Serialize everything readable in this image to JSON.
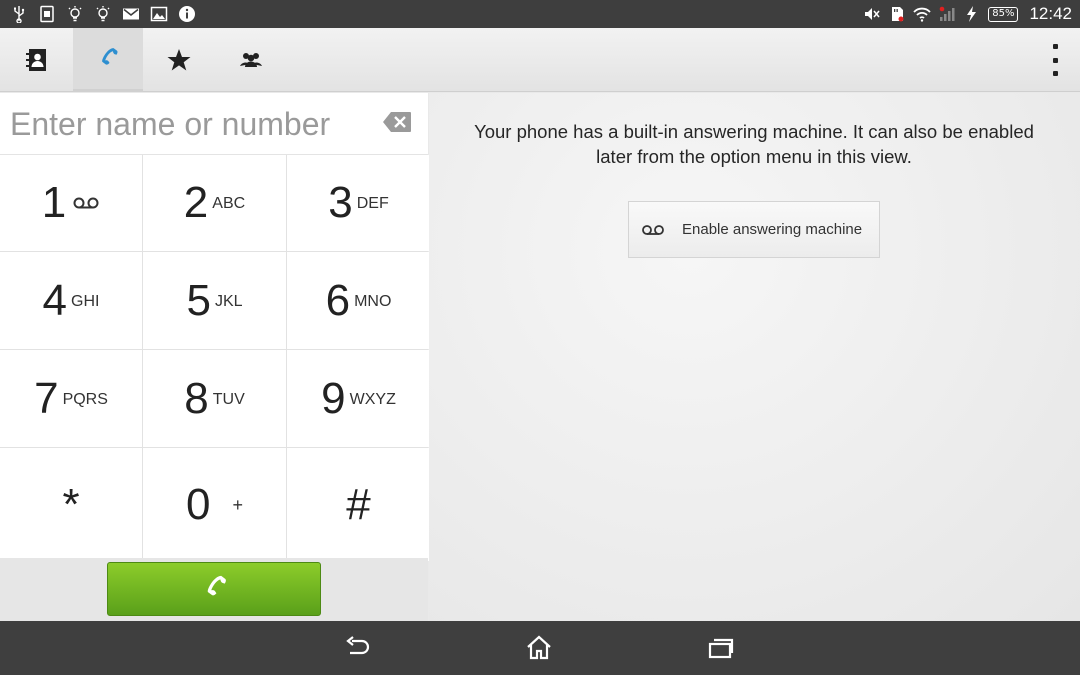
{
  "status_bar": {
    "left_icons": [
      "usb-icon",
      "sim-icon",
      "bulb-icon",
      "bulb-icon",
      "gmail-icon",
      "image-icon",
      "info-icon"
    ],
    "right_icons": [
      "mute-icon",
      "sd-icon",
      "wifi-icon",
      "signal-icon",
      "charging-icon"
    ],
    "battery": "85%",
    "time": "12:42"
  },
  "action_bar": {
    "tabs": [
      {
        "icon": "contacts-icon",
        "active": false
      },
      {
        "icon": "phone-icon",
        "active": true
      },
      {
        "icon": "star-icon",
        "active": false
      },
      {
        "icon": "groups-icon",
        "active": false
      }
    ],
    "overflow_icon": "overflow-menu-icon",
    "accent": "#2e8fd0"
  },
  "dialer": {
    "placeholder": "Enter name or number",
    "value": "",
    "keys": [
      {
        "digit": "1",
        "letters": ""
      },
      {
        "digit": "2",
        "letters": "ABC"
      },
      {
        "digit": "3",
        "letters": "DEF"
      },
      {
        "digit": "4",
        "letters": "GHI"
      },
      {
        "digit": "5",
        "letters": "JKL"
      },
      {
        "digit": "6",
        "letters": "MNO"
      },
      {
        "digit": "7",
        "letters": "PQRS"
      },
      {
        "digit": "8",
        "letters": "TUV"
      },
      {
        "digit": "9",
        "letters": "WXYZ"
      },
      {
        "digit": "*",
        "letters": ""
      },
      {
        "digit": "0",
        "letters": "+"
      },
      {
        "digit": "#",
        "letters": ""
      }
    ],
    "call_color": "#6cb31f"
  },
  "answering": {
    "message": "Your phone has a built-in answering machine. It can also be enabled later from the option menu in this view.",
    "button_label": "Enable answering machine"
  },
  "nav_bar": {
    "buttons": [
      "back-icon",
      "home-icon",
      "recents-icon"
    ]
  }
}
